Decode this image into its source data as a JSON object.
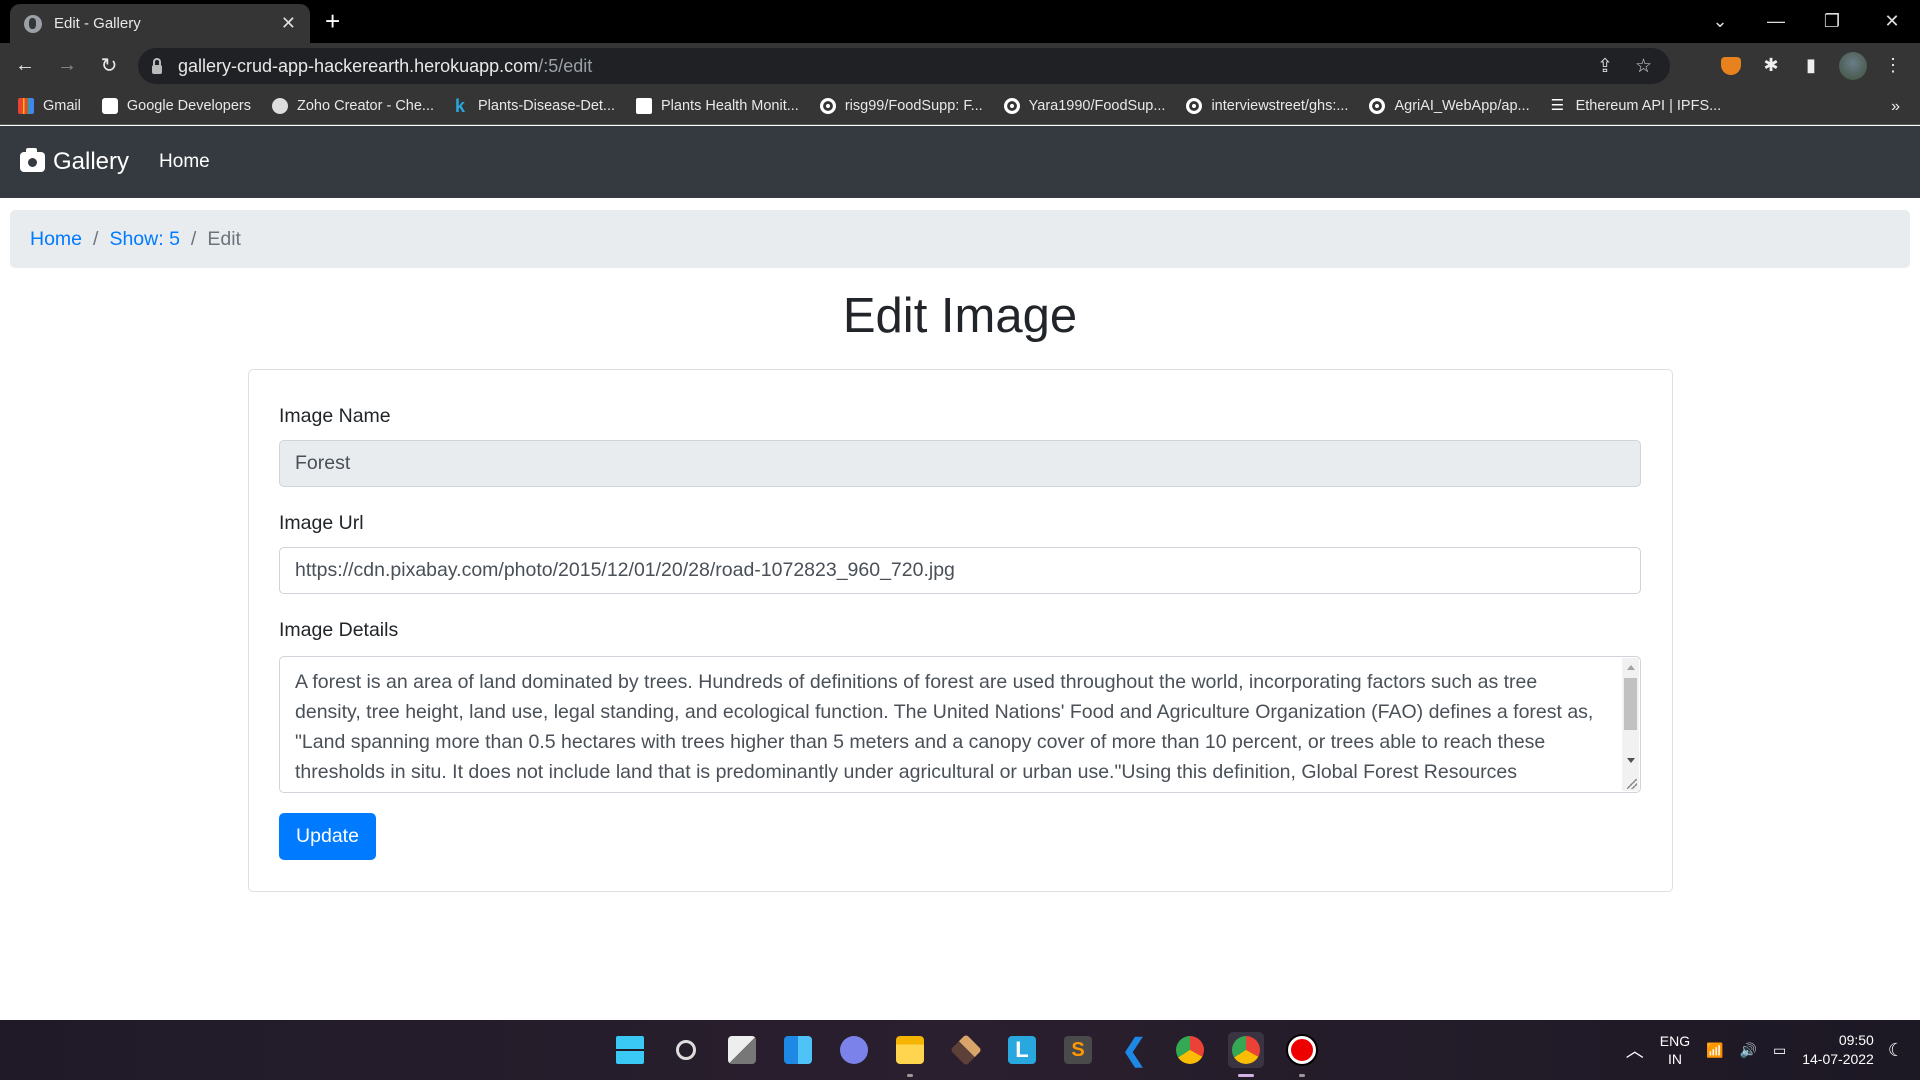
{
  "browser": {
    "tab_title": "Edit - Gallery",
    "url_host": "gallery-crud-app-hackerearth.herokuapp.com",
    "url_path": "/:5/edit",
    "bookmarks": [
      {
        "label": "Gmail",
        "icon": "gmail-icon"
      },
      {
        "label": "Google Developers",
        "icon": "google-developers-icon"
      },
      {
        "label": "Zoho Creator - Che...",
        "icon": "globe-icon"
      },
      {
        "label": "Plants-Disease-Det...",
        "icon": "k-icon"
      },
      {
        "label": "Plants Health Monit...",
        "icon": "chat-icon"
      },
      {
        "label": "risg99/FoodSupp: F...",
        "icon": "github-icon"
      },
      {
        "label": "Yara1990/FoodSup...",
        "icon": "github-icon"
      },
      {
        "label": "interviewstreet/ghs:...",
        "icon": "github-icon"
      },
      {
        "label": "AgriAI_WebApp/ap...",
        "icon": "github-icon"
      },
      {
        "label": "Ethereum API | IPFS...",
        "icon": "ethereum-icon"
      }
    ],
    "bookmarks_more": "»"
  },
  "navbar": {
    "brand": "Gallery",
    "home": "Home"
  },
  "breadcrumb": {
    "home": "Home",
    "show": "Show: 5",
    "current": "Edit",
    "separator": "/"
  },
  "page": {
    "title": "Edit Image"
  },
  "form": {
    "name_label": "Image Name",
    "name_value": "Forest",
    "url_label": "Image Url",
    "url_value": "https://cdn.pixabay.com/photo/2015/12/01/20/28/road-1072823_960_720.jpg",
    "details_label": "Image Details",
    "details_value": "A forest is an area of land dominated by trees. Hundreds of definitions of forest are used throughout the world, incorporating factors such as tree density, tree height, land use, legal standing, and ecological function. The United Nations' Food and Agriculture Organization (FAO) defines a forest as, \"Land spanning more than 0.5 hectares with trees higher than 5 meters and a canopy cover of more than 10 percent, or trees able to reach these thresholds in situ. It does not include land that is predominantly under agricultural or urban use.\"Using this definition, Global Forest Resources",
    "submit_label": "Update"
  },
  "taskbar": {
    "apps": [
      "windows-start",
      "search",
      "task-view",
      "widgets",
      "teams-chat",
      "file-explorer",
      "app-box",
      "app-l",
      "sublime-text",
      "vscode",
      "chrome",
      "chrome-active",
      "recorder"
    ],
    "lang_top": "ENG",
    "lang_bottom": "IN",
    "time": "09:50",
    "date": "14-07-2022"
  },
  "colors": {
    "primary": "#007bff",
    "navbar_bg": "#343a40",
    "breadcrumb_bg": "#e9ecef"
  }
}
